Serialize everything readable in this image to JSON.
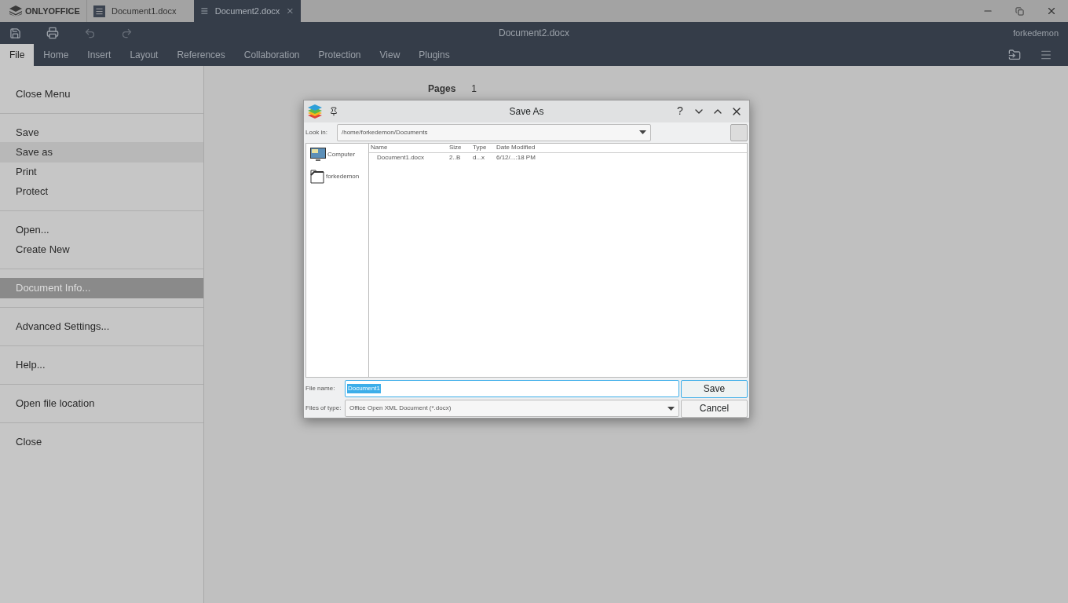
{
  "brand": "ONLYOFFICE",
  "app_tabs": [
    {
      "label": "Document1.docx",
      "selected": false
    },
    {
      "label": "Document2.docx",
      "selected": true
    }
  ],
  "title": "Document2.docx",
  "user": "forkedemon",
  "menu": [
    {
      "label": "File",
      "selected": true
    },
    {
      "label": "Home",
      "selected": false
    },
    {
      "label": "Insert",
      "selected": false
    },
    {
      "label": "Layout",
      "selected": false
    },
    {
      "label": "References",
      "selected": false
    },
    {
      "label": "Collaboration",
      "selected": false
    },
    {
      "label": "Protection",
      "selected": false
    },
    {
      "label": "View",
      "selected": false
    },
    {
      "label": "Plugins",
      "selected": false
    }
  ],
  "file_menu": [
    [
      {
        "label": "Close Menu",
        "selected": false,
        "hovered": false
      }
    ],
    [
      {
        "label": "Save",
        "selected": false,
        "hovered": false
      },
      {
        "label": "Save as",
        "selected": false,
        "hovered": true
      },
      {
        "label": "Print",
        "selected": false,
        "hovered": false
      },
      {
        "label": "Protect",
        "selected": false,
        "hovered": false
      }
    ],
    [
      {
        "label": "Open...",
        "selected": false,
        "hovered": false
      },
      {
        "label": "Create New",
        "selected": false,
        "hovered": false
      }
    ],
    [
      {
        "label": "Document Info...",
        "selected": true,
        "hovered": false
      }
    ],
    [
      {
        "label": "Advanced Settings...",
        "selected": false,
        "hovered": false
      }
    ],
    [
      {
        "label": "Help...",
        "selected": false,
        "hovered": false
      }
    ],
    [
      {
        "label": "Open file location",
        "selected": false,
        "hovered": false
      }
    ],
    [
      {
        "label": "Close",
        "selected": false,
        "hovered": false
      }
    ]
  ],
  "info": {
    "label": "Pages",
    "value": "1"
  },
  "dialog": {
    "title": "Save As",
    "help_glyph": "?",
    "look_in_label": "Look in:",
    "path": "/home/forkedemon/Documents",
    "places": [
      {
        "label": "Computer",
        "kind": "computer"
      },
      {
        "label": "forkedemon",
        "kind": "folder"
      }
    ],
    "columns": [
      "Name",
      "Size",
      "Type",
      "Date Modified"
    ],
    "rows": [
      {
        "cells": [
          "Document1.docx",
          "2..B",
          "d...x",
          "6/12/...:18 PM"
        ]
      }
    ],
    "file_name_label": "File name:",
    "file_name": "Document1",
    "file_type_label": "Files of type:",
    "file_type": "Office Open XML Document (*.docx)",
    "buttons": [
      "Save",
      "Cancel"
    ]
  }
}
